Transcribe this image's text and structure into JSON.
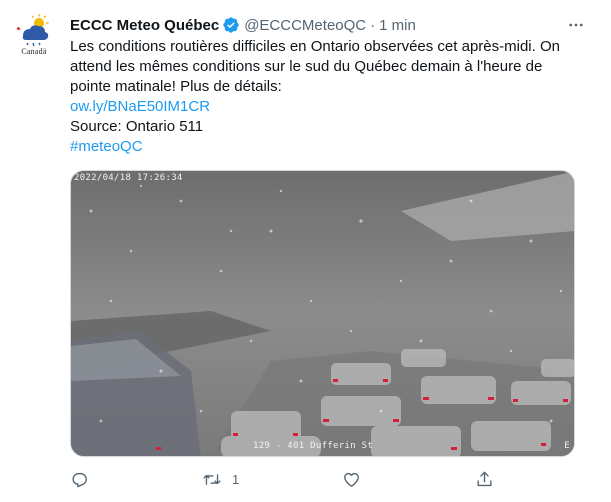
{
  "tweet": {
    "author_name": "ECCC Meteo Québec",
    "author_handle": "@ECCCMeteoQC",
    "separator": "·",
    "time": "1 min",
    "avatar_caption": "Canadä",
    "text_lines": [
      "Les conditions routières difficiles en Ontario observées cet après-midi. On",
      "attend les mêmes conditions sur le sud du Québec demain à l'heure de",
      "pointe matinale! Plus de détails:"
    ],
    "link": "ow.ly/BNaE50IM1CR",
    "source": "Source: Ontario 511",
    "hashtag": "#meteoQC",
    "media": {
      "timestamp": "2022/04/18  17:26:34",
      "location": "129 - 401 Dufferin St",
      "corner_mark": "E"
    },
    "actions": {
      "reply": {
        "icon": "reply-icon",
        "count": ""
      },
      "retweet": {
        "icon": "retweet-icon",
        "count": "1"
      },
      "like": {
        "icon": "heart-icon",
        "count": ""
      },
      "share": {
        "icon": "share-icon",
        "count": ""
      }
    },
    "verified": true
  },
  "colors": {
    "link": "#1d9bf0",
    "verified": "#1d9bf0",
    "muted": "#536471",
    "text": "#0f1419"
  }
}
